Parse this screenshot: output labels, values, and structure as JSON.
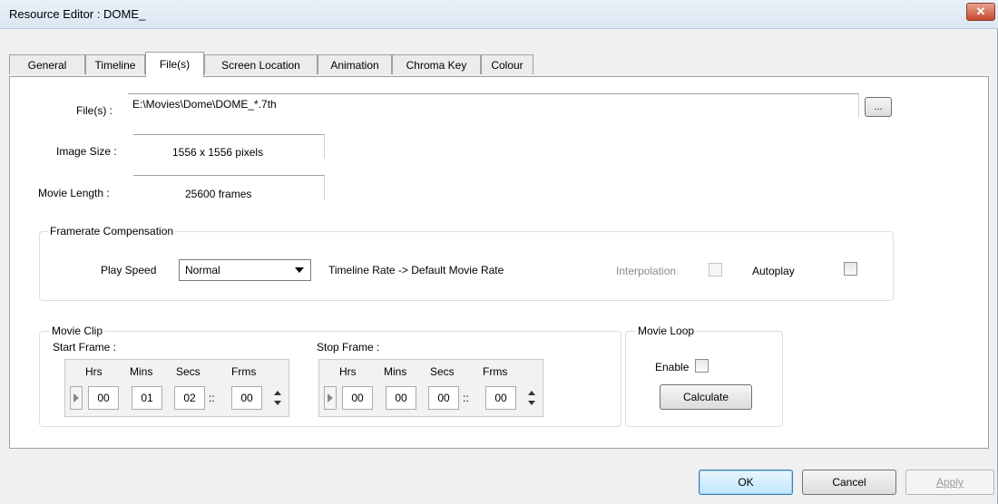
{
  "window": {
    "title": "Resource Editor  :  DOME_",
    "close_glyph": "✕"
  },
  "tabs": [
    {
      "label": "General"
    },
    {
      "label": "Timeline"
    },
    {
      "label": "File(s)"
    },
    {
      "label": "Screen Location"
    },
    {
      "label": "Animation"
    },
    {
      "label": "Chroma Key"
    },
    {
      "label": "Colour"
    }
  ],
  "active_tab": "File(s)",
  "files": {
    "label": "File(s) :",
    "value": "E:\\Movies\\Dome\\DOME_*.7th",
    "browse_label": "..."
  },
  "image_size": {
    "label": "Image Size :",
    "value": "1556 x 1556 pixels"
  },
  "movie_length": {
    "label": "Movie Length :",
    "value": "25600  frames"
  },
  "framerate": {
    "title": "Framerate Compensation",
    "play_speed_label": "Play Speed",
    "play_speed_value": "Normal",
    "rate_text": "Timeline Rate -> Default Movie Rate",
    "interpolation_label": "Interpolation",
    "interpolation_checked": false,
    "interpolation_enabled": false,
    "autoplay_label": "Autoplay",
    "autoplay_checked": false
  },
  "movie_clip": {
    "title": "Movie Clip",
    "start": {
      "label": "Start Frame :",
      "hrs": "00",
      "mins": "01",
      "secs": "02",
      "frms": "00"
    },
    "stop": {
      "label": "Stop Frame :",
      "hrs": "00",
      "mins": "00",
      "secs": "00",
      "frms": "00"
    },
    "headers": {
      "hrs": "Hrs",
      "mins": "Mins",
      "secs": "Secs",
      "frms": "Frms"
    },
    "separator": "::"
  },
  "movie_loop": {
    "title": "Movie Loop",
    "enable_label": "Enable",
    "enable_checked": false,
    "calculate_label": "Calculate"
  },
  "footer": {
    "ok_label": "OK",
    "cancel_label": "Cancel",
    "apply_label": "Apply"
  }
}
